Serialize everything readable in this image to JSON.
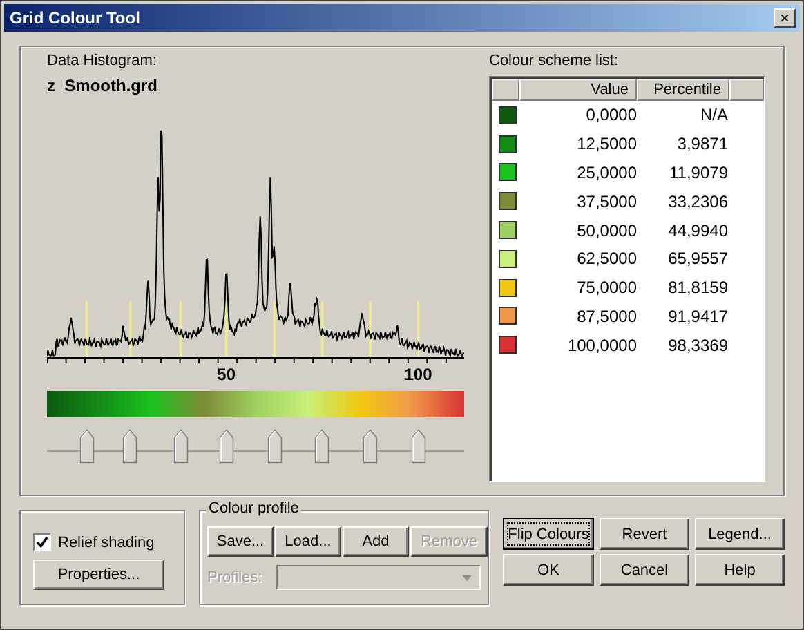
{
  "window": {
    "title": "Grid Colour Tool",
    "close": "×"
  },
  "histogram": {
    "label": "Data Histogram:",
    "file": "z_Smooth.grd",
    "axis_labels": [
      "50",
      "100"
    ],
    "markers": [
      {
        "level": 0.095
      },
      {
        "level": 0.2
      },
      {
        "level": 0.32
      },
      {
        "level": 0.43
      },
      {
        "level": 0.545
      },
      {
        "level": 0.66
      },
      {
        "level": 0.775
      },
      {
        "level": 0.89
      }
    ]
  },
  "colour_list": {
    "label": "Colour scheme list:",
    "columns": [
      "Value",
      "Percentile"
    ],
    "rows": [
      {
        "color": "#0d5a10",
        "value": "0,0000",
        "percentile": "N/A"
      },
      {
        "color": "#138a18",
        "value": "12,5000",
        "percentile": "3,9871"
      },
      {
        "color": "#1bc21d",
        "value": "25,0000",
        "percentile": "11,9079"
      },
      {
        "color": "#7d8a38",
        "value": "37,5000",
        "percentile": "33,2306"
      },
      {
        "color": "#9ed060",
        "value": "50,0000",
        "percentile": "44,9940"
      },
      {
        "color": "#c8f07a",
        "value": "62,5000",
        "percentile": "65,9557"
      },
      {
        "color": "#f0c810",
        "value": "75,0000",
        "percentile": "81,8159"
      },
      {
        "color": "#f0984a",
        "value": "87,5000",
        "percentile": "91,9417"
      },
      {
        "color": "#d83434",
        "value": "100,0000",
        "percentile": "98,3369"
      }
    ]
  },
  "relief": {
    "label": "Relief shading",
    "checked": true,
    "button": "Properties..."
  },
  "colour_profile": {
    "title": "Colour profile",
    "buttons": [
      {
        "label": "Save...",
        "disabled": false
      },
      {
        "label": "Load...",
        "disabled": false
      },
      {
        "label": "Add",
        "disabled": false
      },
      {
        "label": "Remove",
        "disabled": true
      }
    ],
    "profiles_label": "Profiles:",
    "profiles_disabled": true
  },
  "buttons": [
    {
      "label": "Flip Colours",
      "focused": true
    },
    {
      "label": "Revert",
      "focused": false
    },
    {
      "label": "Legend...",
      "focused": false
    },
    {
      "label": "OK",
      "focused": false
    },
    {
      "label": "Cancel",
      "focused": false
    },
    {
      "label": "Help",
      "focused": false
    }
  ]
}
